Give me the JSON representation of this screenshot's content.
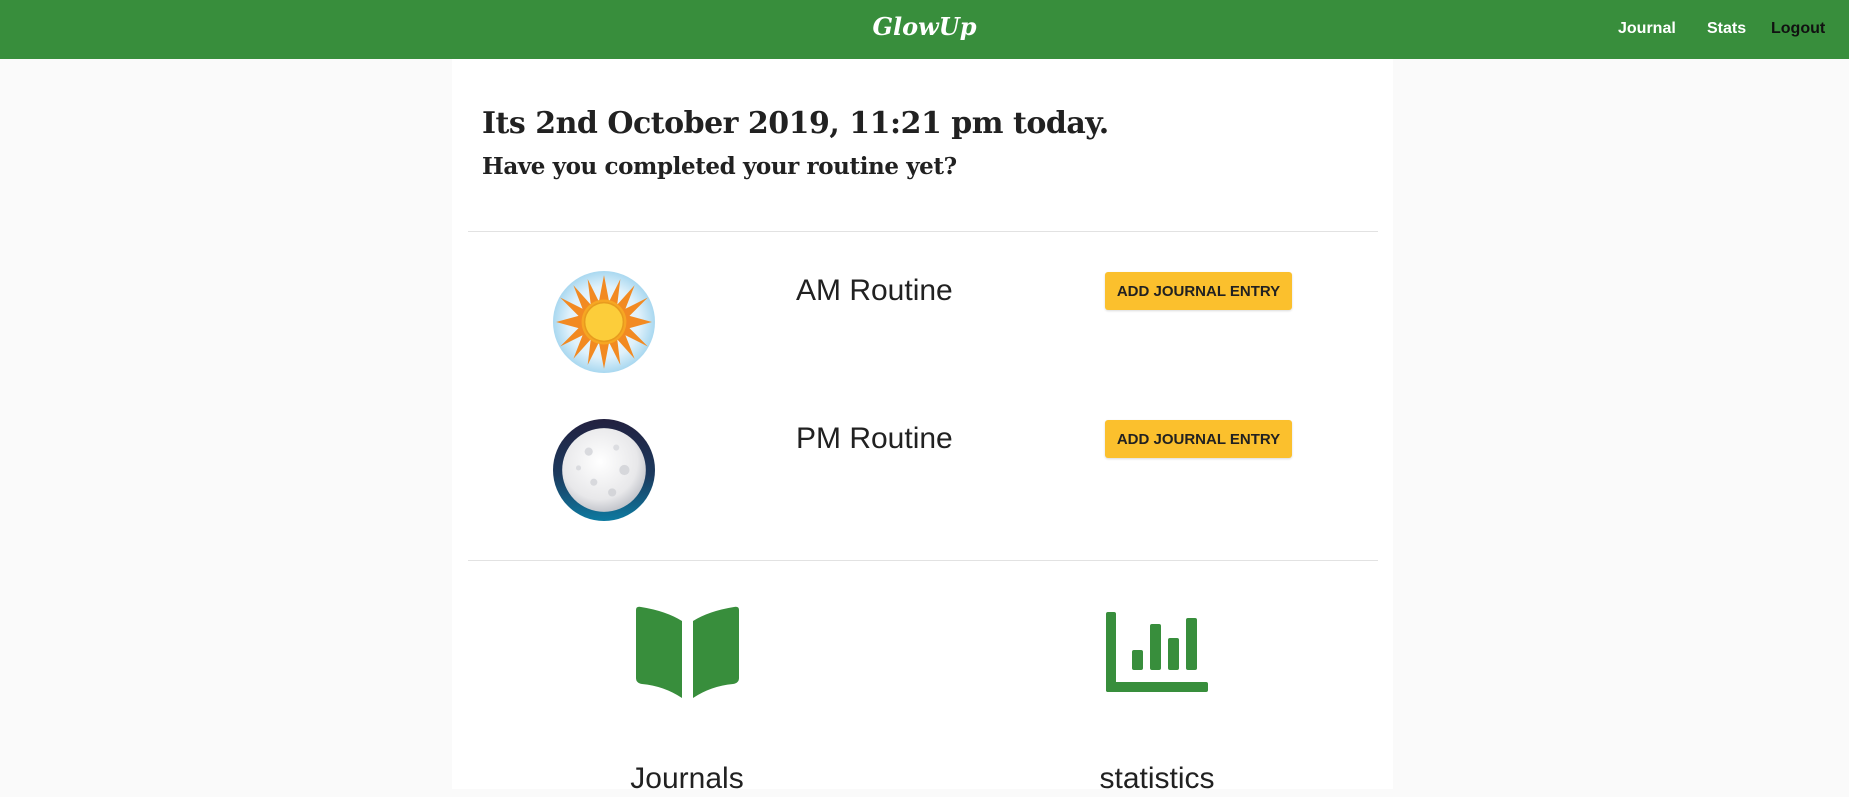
{
  "navbar": {
    "brand": "GlowUp",
    "links": {
      "journal": "Journal",
      "stats": "Stats",
      "logout": "Logout"
    },
    "color": "#388e3c"
  },
  "header": {
    "headline": "Its 2nd October 2019, 11:21 pm today.",
    "subline": "Have you completed your routine yet?"
  },
  "routines": {
    "am": {
      "title": "AM Routine",
      "button": "ADD JOURNAL ENTRY",
      "icon": "sun-icon"
    },
    "pm": {
      "title": "PM Routine",
      "button": "ADD JOURNAL ENTRY",
      "icon": "moon-icon"
    }
  },
  "shortcuts": {
    "journals": {
      "label": "Journals",
      "icon": "book-icon"
    },
    "statistics": {
      "label": "statistics",
      "icon": "bar-chart-icon"
    }
  },
  "colors": {
    "accent_button": "#fbc02d",
    "icon_green": "#388e3c"
  }
}
